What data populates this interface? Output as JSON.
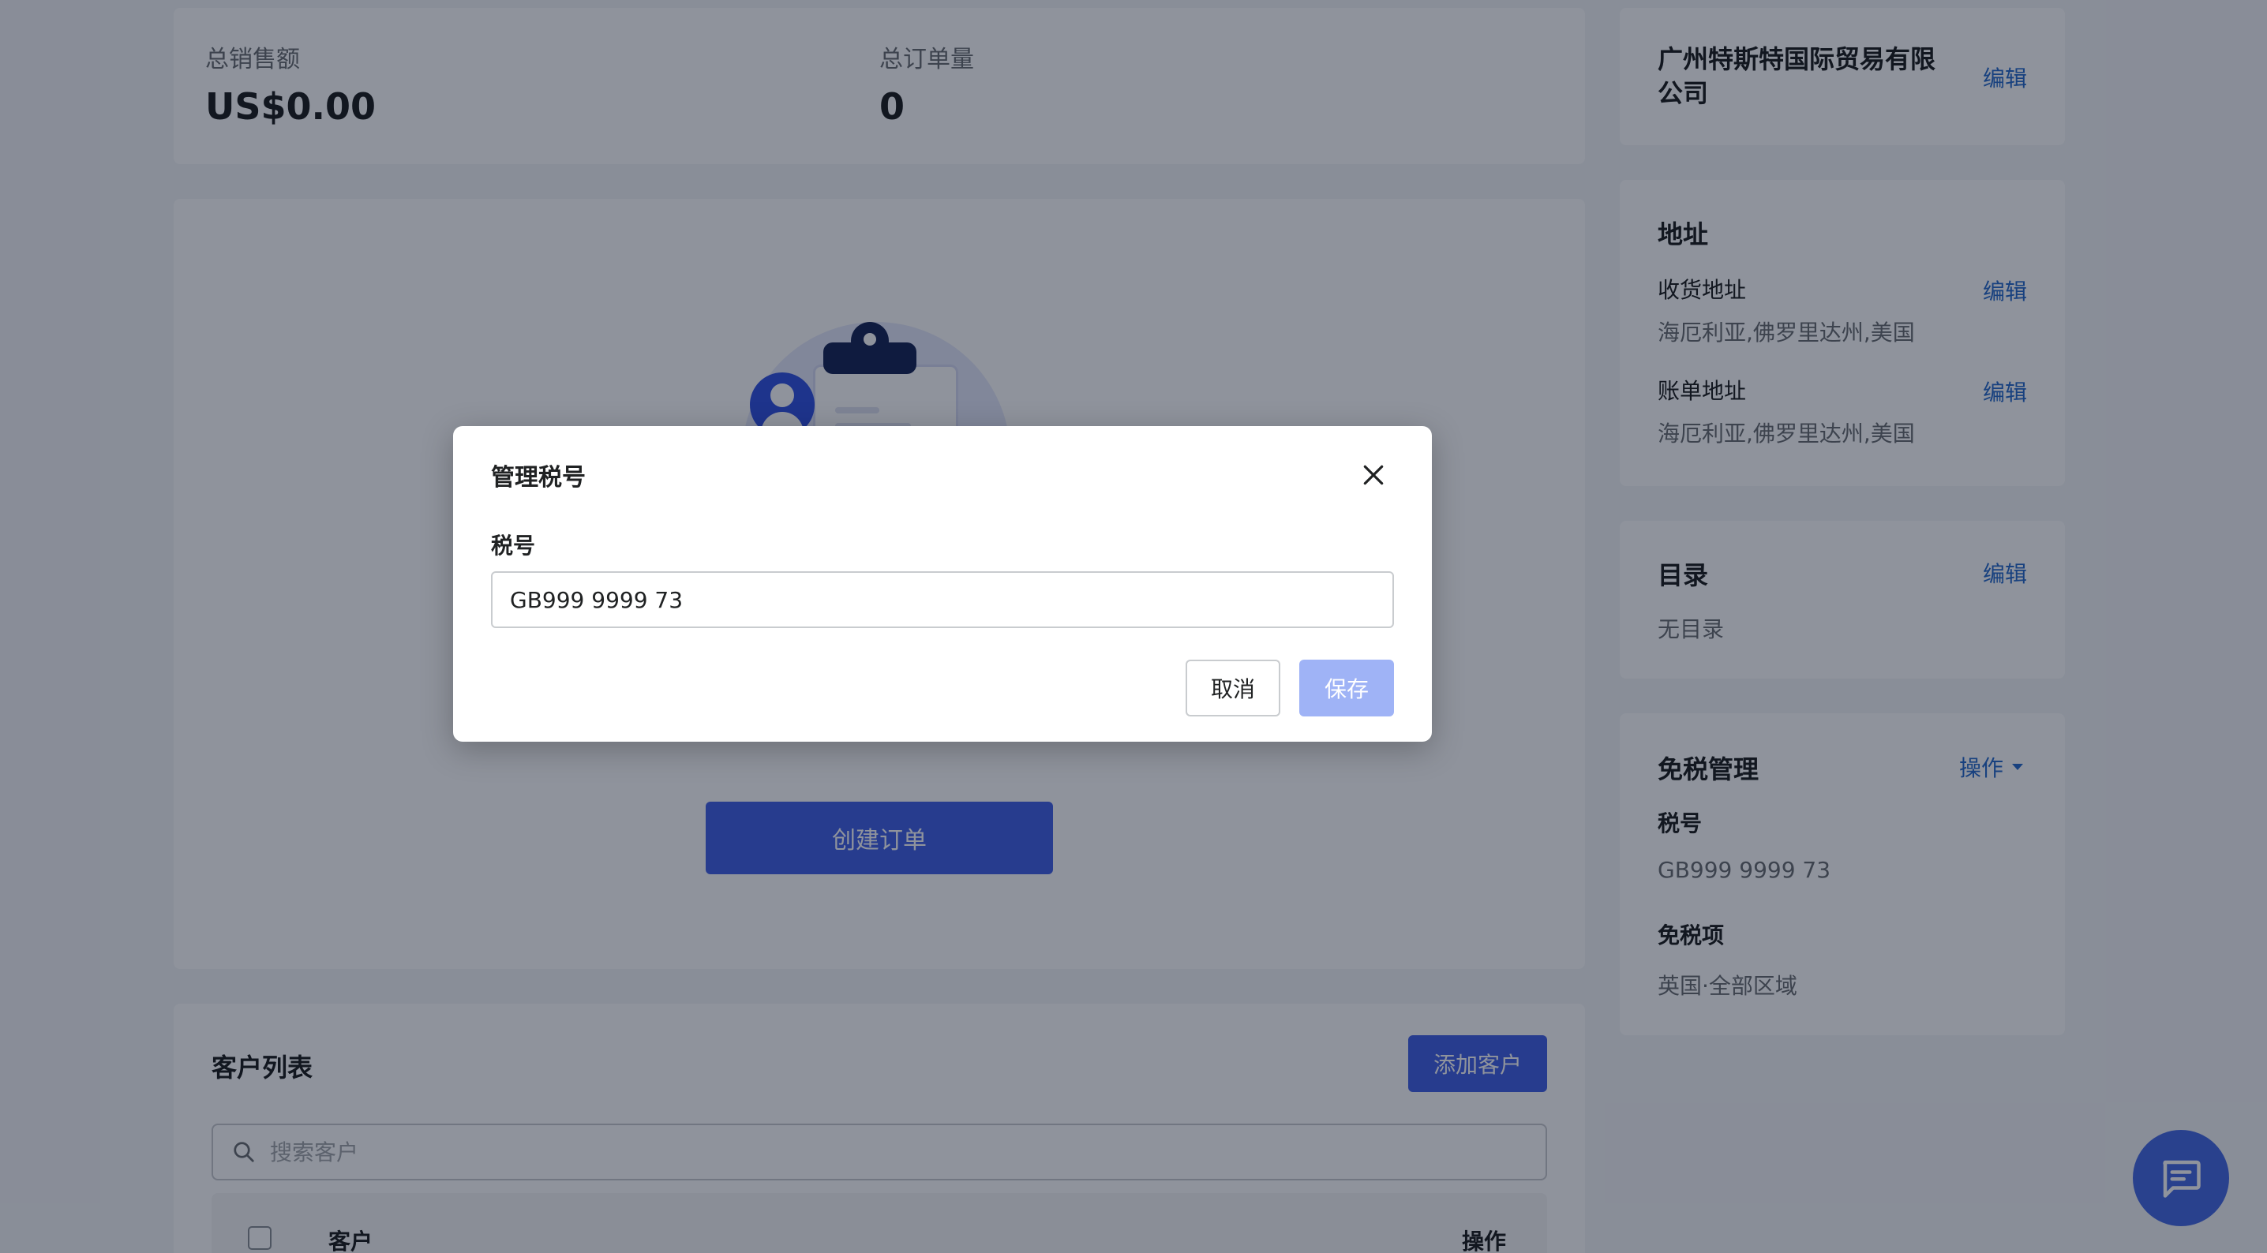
{
  "stats": {
    "total_sales_label": "总销售额",
    "total_sales_value": "US$0.00",
    "total_orders_label": "总订单量",
    "total_orders_value": "0"
  },
  "empty_state": {
    "create_order_label": "创建订单"
  },
  "customers": {
    "title": "客户列表",
    "add_button": "添加客户",
    "search_placeholder": "搜索客户",
    "col_customer": "客户",
    "col_actions": "操作"
  },
  "sidebar": {
    "company_name": "广州特斯特国际贸易有限公司",
    "company_edit": "编辑",
    "address_title": "地址",
    "shipping_label": "收货地址",
    "shipping_edit": "编辑",
    "shipping_value": "海厄利亚,佛罗里达州,美国",
    "billing_label": "账单地址",
    "billing_edit": "编辑",
    "billing_value": "海厄利亚,佛罗里达州,美国",
    "catalog_title": "目录",
    "catalog_edit": "编辑",
    "catalog_value": "无目录",
    "tax_title": "免税管理",
    "tax_actions": "操作",
    "tax_id_label": "税号",
    "tax_id_value": "GB999 9999 73",
    "exemption_label": "免税项",
    "exemption_value": "英国·全部区域"
  },
  "modal": {
    "title": "管理税号",
    "field_label": "税号",
    "field_value": "GB999 9999 73",
    "cancel_label": "取消",
    "save_label": "保存"
  },
  "colors": {
    "accent": "#4665e6",
    "link": "#2c6ecb",
    "save_disabled": "#9fb3f6"
  }
}
